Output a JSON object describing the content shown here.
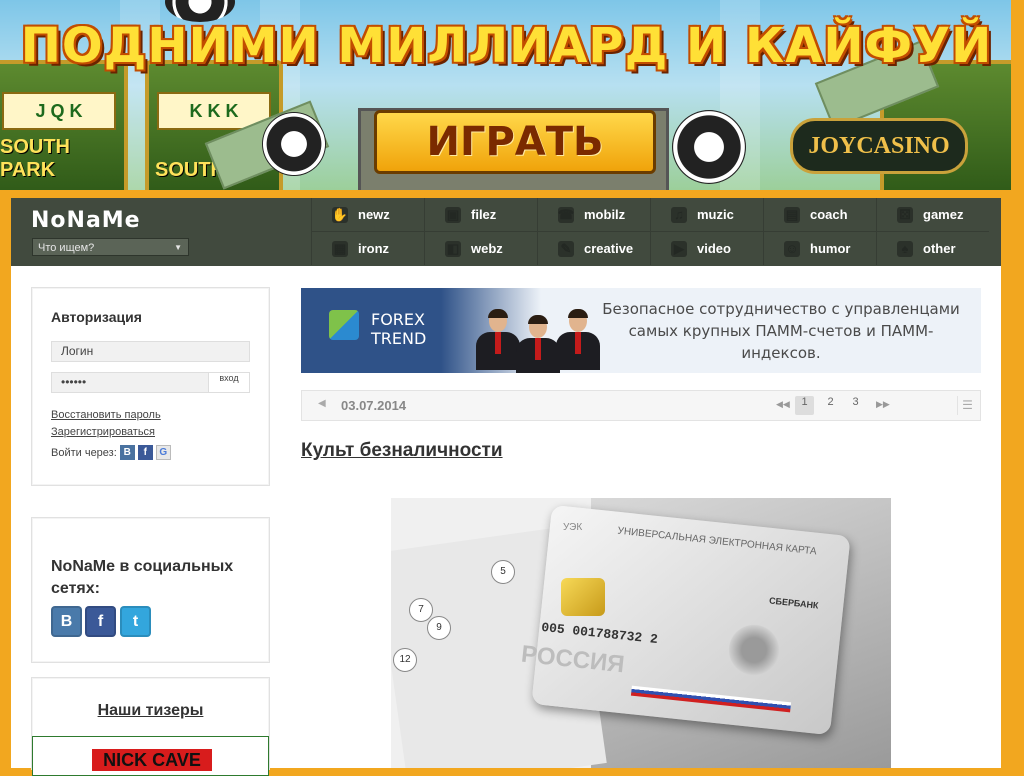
{
  "banner": {
    "headline": "ПОДНИМИ МИЛЛИАРД И КАЙФУЙ",
    "play_label": "ИГРАТЬ",
    "brand": "JOYCASINO",
    "slot_left_text": "SOUTH PARK",
    "slot_right_text": "SOUTH P",
    "reels_left": "J Q K",
    "reels_right": "K K K"
  },
  "site": {
    "logo": "NoNaMe",
    "search_placeholder": "Что ищем?"
  },
  "nav": {
    "items": [
      {
        "label": "newz",
        "icon": "hand-icon"
      },
      {
        "label": "filez",
        "icon": "floppy-icon"
      },
      {
        "label": "mobilz",
        "icon": "phone-icon"
      },
      {
        "label": "muzic",
        "icon": "headphones-icon"
      },
      {
        "label": "coach",
        "icon": "clipboard-icon"
      },
      {
        "label": "gamez",
        "icon": "dice-icon"
      },
      {
        "label": "ironz",
        "icon": "chip-icon"
      },
      {
        "label": "webz",
        "icon": "browser-icon"
      },
      {
        "label": "creative",
        "icon": "palette-icon"
      },
      {
        "label": "video",
        "icon": "film-icon"
      },
      {
        "label": "humor",
        "icon": "smile-icon"
      },
      {
        "label": "other",
        "icon": "cards-icon"
      }
    ]
  },
  "auth": {
    "title": "Авторизация",
    "login_value": "Логин",
    "password_value": "••••••",
    "enter_label": "вход",
    "restore_link": "Восстановить пароль",
    "register_link": "Зарегистрироваться",
    "login_via": "Войти через:",
    "via_vk": "В",
    "via_fb": "f",
    "via_google": "G"
  },
  "social": {
    "title": "NoNaMe в социальных сетях:",
    "vk": "В",
    "fb": "f",
    "tw": "t"
  },
  "teasers": {
    "title": "Наши тизеры",
    "image_text": "NICK CAVE"
  },
  "ad": {
    "brand_line1": "FOREX",
    "brand_line2": "TREND",
    "text": "Безопасное сотрудничество с управленцами самых крупных ПАММ-счетов и ПАММ-индексов."
  },
  "pager": {
    "date": "03.07.2014",
    "pages": [
      "1",
      "2",
      "3"
    ],
    "active_page": "1"
  },
  "article": {
    "title": "Культ безналичности"
  },
  "photo": {
    "uek": "УЭК",
    "card_title": "УНИВЕРСАЛЬНАЯ ЭЛЕКТРОННАЯ КАРТА",
    "card_number": "005 001788732 2",
    "country": "РОССИЯ",
    "bank": "СБЕРБАНК",
    "numbers": [
      "5",
      "7",
      "9",
      "12"
    ]
  },
  "colors": {
    "page_bg": "#f2a71f",
    "nav_bg": "#414a3e",
    "ad_blue": "#2f5288"
  }
}
